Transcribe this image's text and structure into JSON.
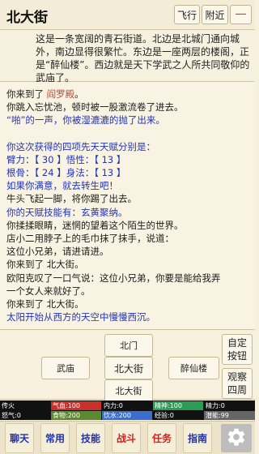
{
  "header": {
    "location": "北大街",
    "fly_label": "飞行",
    "near_label": "附近",
    "menu_label": "一"
  },
  "description": "这是一条宽阔的青石街道。北边是北城门通向城外，南边显得很繁忙。东边是一座两层的楼阁，正是“醉仙楼”。西边就是天下学武之人所共同敬仰的武庙了。",
  "log": {
    "line1_prefix": "你来到了",
    "line1_place": "阎罗殿",
    "line1_suffix": "。",
    "line2": "你跳入忘忧池，顿时被一股激流卷了进去。",
    "line3": "“啪”的一声，你被湿漉漉的抛了出来。",
    "line4": "你这次获得的四项先天天赋分别是：",
    "line5": "臂力：【 30 】悟性：【 13 】",
    "line6": "根骨：【 24 】身法：【 13 】",
    "line7": "如果你满意，就去转生吧！",
    "line8": "牛头飞起一脚，将你踢了出去。",
    "line9": "你的天赋技能有：玄黄聚纳。",
    "line10": "你揉揉眼睛，迷惘的望着这个陌生的世界。",
    "line11": "店小二用脖子上的毛巾抹了抹手，说道：",
    "line12": "这位小兄弟，请进请进。",
    "line13": "你来到了 北大街。",
    "line14": "欧阳克叹了一口气说：这位小兄弟，你要是能给我弄",
    "line15": "一个女人来就好了。",
    "line16": "你来到了 北大街。",
    "line17": "太阳开始从西方的天空中慢慢西沉。"
  },
  "map": {
    "north": "北门",
    "west": "武庙",
    "here": "北大街",
    "east": "醉仙楼",
    "south": "北大街",
    "custom_label": "自定按钮",
    "observe_label": "观察四周"
  },
  "status": {
    "row1": [
      {
        "label": "传火",
        "color": "#111111",
        "fill": 0
      },
      {
        "label": "气血:100",
        "color": "#c8302c",
        "fill": 1.0
      },
      {
        "label": "内力:0",
        "color": "#2d6ad6",
        "fill": 0
      },
      {
        "label": "精神:100",
        "color": "#2c9b55",
        "fill": 1.0
      },
      {
        "label": "精力:0",
        "color": "#c88a1a",
        "fill": 0
      }
    ],
    "row2": [
      {
        "label": "怒气:0",
        "color": "#9b2bb5",
        "fill": 0
      },
      {
        "label": "食物:200",
        "color": "#5b8a2e",
        "fill": 1.0
      },
      {
        "label": "饮水:200",
        "color": "#3a6fd0",
        "fill": 1.0
      },
      {
        "label": "经验:0",
        "color": "#555555",
        "fill": 0
      },
      {
        "label": "潜能:99",
        "color": "#666666",
        "fill": 1.0
      }
    ]
  },
  "tabs": {
    "chat": "聊天",
    "common": "常用",
    "skill": "技能",
    "battle": "战斗",
    "task": "任务",
    "guide": "指南"
  },
  "icons": {
    "settings": "gear-icon"
  }
}
